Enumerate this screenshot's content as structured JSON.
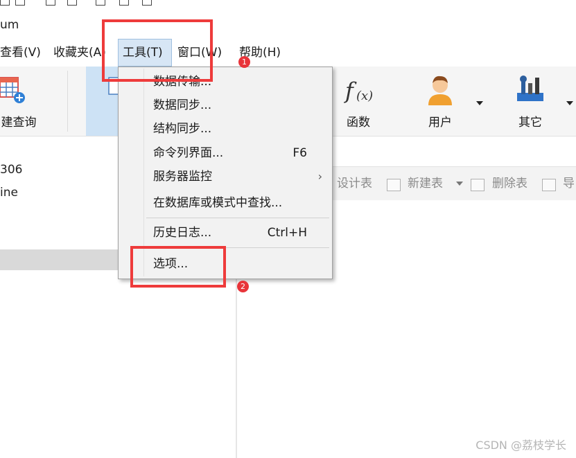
{
  "window": {
    "title_fragment": "um"
  },
  "menubar": {
    "items": [
      {
        "label": "查看(V)"
      },
      {
        "label": "收藏夹(A)"
      },
      {
        "label": "工具(T)"
      },
      {
        "label": "窗口(W)"
      },
      {
        "label": "帮助(H)"
      }
    ]
  },
  "toolbar": {
    "items": [
      {
        "label": "建查询",
        "icon": "new-query-icon"
      },
      {
        "label": "函数",
        "icon": "function-icon"
      },
      {
        "label": "用户",
        "icon": "user-icon"
      },
      {
        "label": "其它",
        "icon": "other-tools-icon"
      }
    ]
  },
  "left_panel": {
    "lines": [
      "306",
      "ine"
    ]
  },
  "object_toolbar": {
    "items": [
      {
        "label": "设计表"
      },
      {
        "label": "新建表"
      },
      {
        "label": "删除表"
      },
      {
        "label": "导"
      }
    ]
  },
  "tools_menu": {
    "items": [
      {
        "label": "数据传输..."
      },
      {
        "label": "数据同步..."
      },
      {
        "label": "结构同步..."
      },
      {
        "label": "命令列界面...",
        "shortcut": "F6"
      },
      {
        "label": "服务器监控",
        "submenu": "›"
      },
      {
        "label": "在数据库或模式中查找..."
      },
      {
        "label": "历史日志...",
        "shortcut": "Ctrl+H"
      },
      {
        "label": "选项..."
      }
    ]
  },
  "annotations": {
    "badge1": "1",
    "badge2": "2",
    "color": "#ee3b3b"
  },
  "watermark": "CSDN @荔枝学长"
}
